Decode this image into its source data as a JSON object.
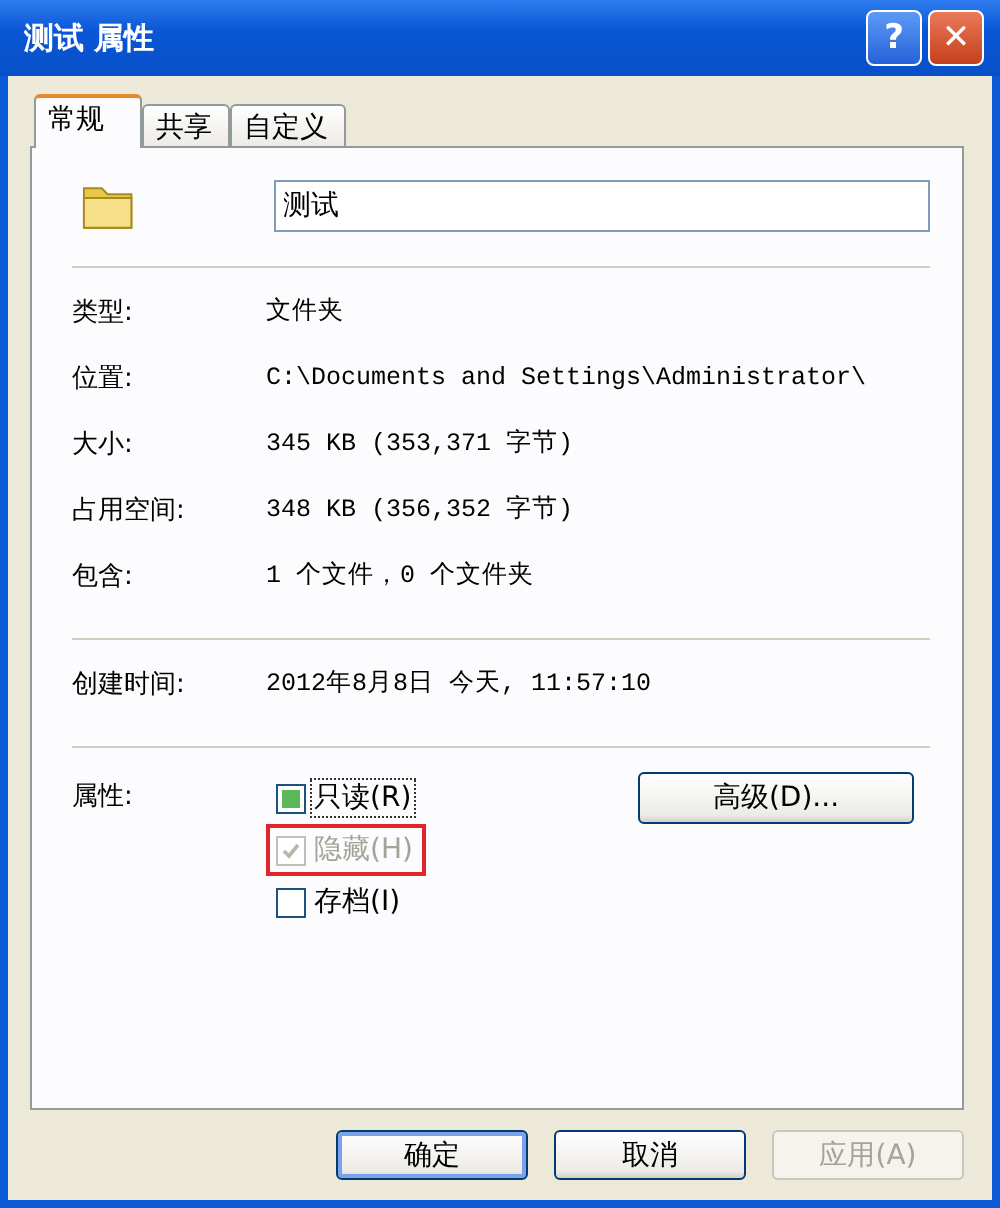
{
  "window": {
    "title": "测试 属性"
  },
  "title_buttons": [
    {
      "kind": "help",
      "label": "?"
    },
    {
      "kind": "close",
      "label": "✕"
    }
  ],
  "tabs": [
    {
      "label": "常规",
      "selected": true
    },
    {
      "label": "共享",
      "selected": false
    },
    {
      "label": "自定义",
      "selected": false
    }
  ],
  "name_field": {
    "value": "测试"
  },
  "info_groups": [
    [
      {
        "label": "类型:",
        "value": "文件夹"
      },
      {
        "label": "位置:",
        "value": "C:\\Documents and Settings\\Administrator\\"
      },
      {
        "label": "大小:",
        "value": "345 KB (353,371 字节)"
      },
      {
        "label": "占用空间:",
        "value": "348 KB (356,352 字节)"
      },
      {
        "label": "包含:",
        "value": "1 个文件，0 个文件夹"
      }
    ],
    [
      {
        "label": "创建时间:",
        "value": "2012年8月8日 今天, 11:57:10"
      }
    ]
  ],
  "attributes": {
    "label": "属性:",
    "advanced_button": "高级(D)...",
    "checkboxes": [
      {
        "label": "只读(R)",
        "checked": false,
        "mixed": true,
        "disabled": false,
        "focused": true,
        "highlighted": false
      },
      {
        "label": "隐藏(H)",
        "checked": true,
        "mixed": false,
        "disabled": true,
        "focused": false,
        "highlighted": true
      },
      {
        "label": "存档(I)",
        "checked": false,
        "mixed": false,
        "disabled": false,
        "focused": false,
        "highlighted": false
      }
    ]
  },
  "buttons": [
    {
      "label": "确定",
      "default": true,
      "disabled": false
    },
    {
      "label": "取消",
      "default": false,
      "disabled": false
    },
    {
      "label": "应用(A)",
      "default": false,
      "disabled": true
    }
  ]
}
